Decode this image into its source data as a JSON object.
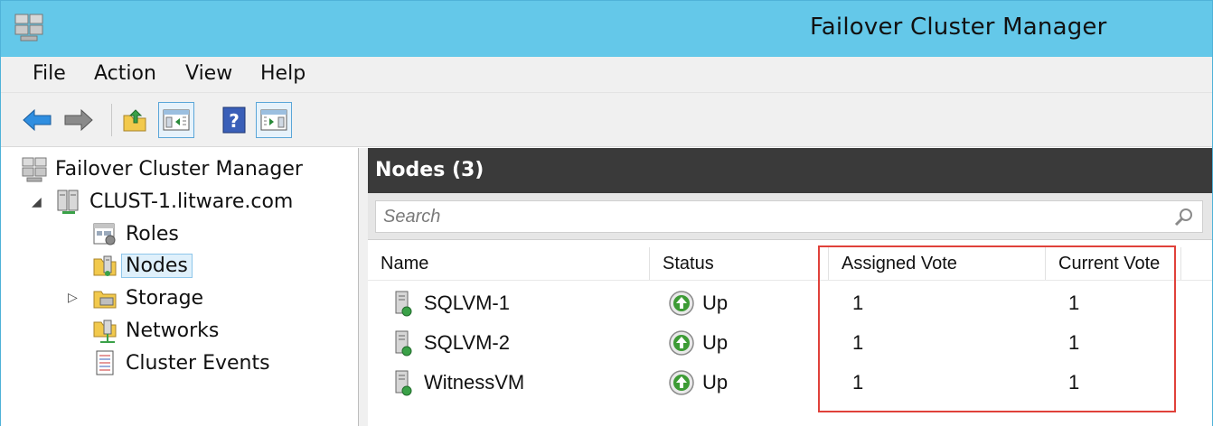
{
  "window": {
    "title": "Failover Cluster Manager"
  },
  "menu": {
    "items": [
      "File",
      "Action",
      "View",
      "Help"
    ]
  },
  "toolbar": {
    "buttons": [
      "back-icon",
      "forward-icon",
      "up-folder-icon",
      "show-hide-console-tree-icon",
      "help-icon",
      "show-hide-action-pane-icon"
    ]
  },
  "tree": {
    "root": "Failover Cluster Manager",
    "cluster": "CLUST-1.litware.com",
    "children": [
      "Roles",
      "Nodes",
      "Storage",
      "Networks",
      "Cluster Events"
    ],
    "selected": "Nodes"
  },
  "pane": {
    "title": "Nodes (3)",
    "search_placeholder": "Search",
    "columns": [
      "Name",
      "Status",
      "Assigned Vote",
      "Current Vote"
    ],
    "rows": [
      {
        "name": "SQLVM-1",
        "status": "Up",
        "assigned_vote": "1",
        "current_vote": "1"
      },
      {
        "name": "SQLVM-2",
        "status": "Up",
        "assigned_vote": "1",
        "current_vote": "1"
      },
      {
        "name": "WitnessVM",
        "status": "Up",
        "assigned_vote": "1",
        "current_vote": "1"
      }
    ]
  },
  "colors": {
    "titlebar": "#64c8e9",
    "pane_header": "#3a3a3a",
    "highlight": "#e0413a",
    "status_up": "#3d9b35"
  }
}
